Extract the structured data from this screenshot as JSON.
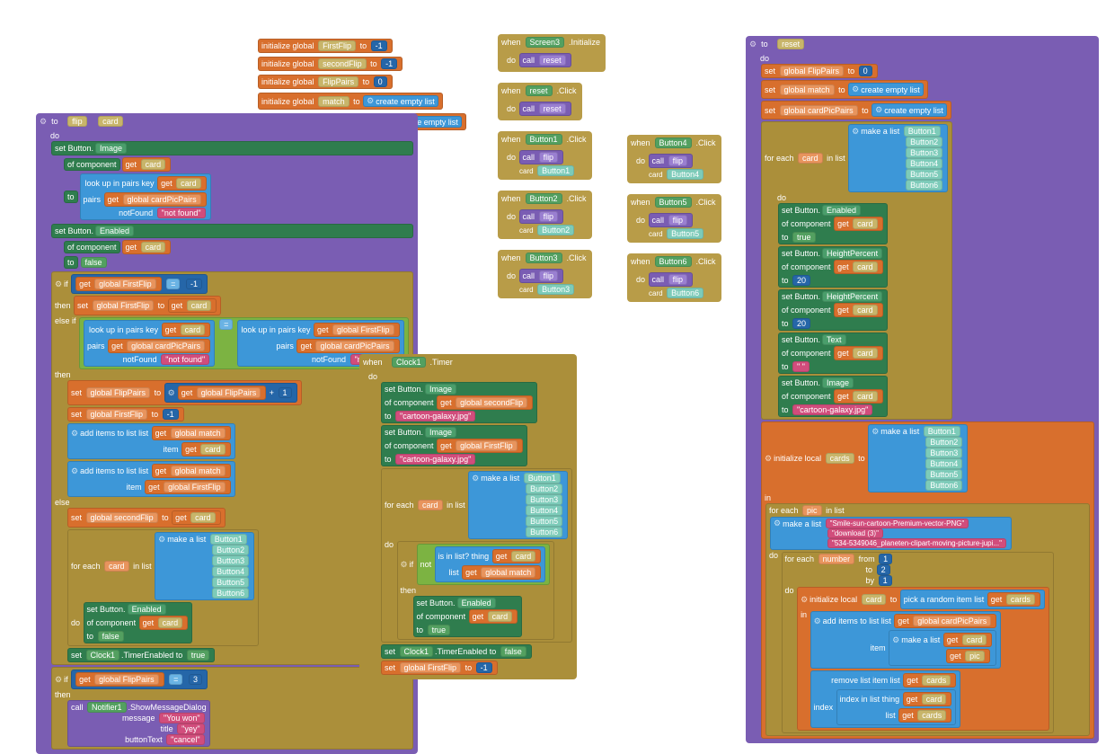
{
  "kw": {
    "when": "when",
    "do": "do",
    "to": "to",
    "call": "call",
    "set": "set",
    "get": "get",
    "of_component": "of component",
    "for_each": "for each",
    "in_list": "in list",
    "if": "if",
    "then": "then",
    "else_if": "else if",
    "else": "else",
    "initialize_global": "initialize global",
    "initialize_local": "initialize local",
    "in": "in",
    "from": "from",
    "by": "by",
    "make_a_list": "make a list",
    "create_empty_list": "create empty list",
    "look_up_pairs_key": "look up in pairs  key",
    "pairs": "pairs",
    "notFound": "notFound",
    "add_items_list": "add items to list  list",
    "item": "item",
    "is_in_list": "is in list? thing",
    "list": "list",
    "pick_random": "pick a random item  list",
    "remove_list_item": "remove list item  list",
    "index": "index",
    "index_in_list": "index in list  thing",
    "set_button": "set Button.",
    "message": "message",
    "title": "title",
    "buttonText": "buttonText",
    "number": "number",
    "card": "card",
    "pic": "pic",
    "cards": "cards"
  },
  "globals": {
    "firstFlip": "FirstFlip",
    "secondFlip": "secondFlip",
    "flipPairs": "FlipPairs",
    "match": "match",
    "cardPicPairs": "cardPicPairs"
  },
  "g_init": {
    "firstFlip_val": "-1",
    "secondFlip_val": "-1",
    "flipPairs_val": "0"
  },
  "comp": {
    "screen3": "Screen3",
    "clock1": "Clock1",
    "notifier1": "Notifier1"
  },
  "events": {
    "initialize": ".Initialize",
    "click": ".Click",
    "timer": ".Timer"
  },
  "procs": {
    "reset": "reset",
    "flip": "flip"
  },
  "props": {
    "image": "Image",
    "enabled": "Enabled",
    "heightPercent": "HeightPercent",
    "text": "Text",
    "timerEnabled": ".TimerEnabled"
  },
  "buttons": [
    "Button1",
    "Button2",
    "Button3",
    "Button4",
    "Button5",
    "Button6"
  ],
  "vals": {
    "false": "false",
    "true": "true",
    "neg1": "-1",
    "one": "1",
    "two": "2",
    "three": "3",
    "twenty": "20",
    "zero": "0",
    "eq": "=",
    "plus": "+",
    "notfound_txt": "not found",
    "quote": "\" \"",
    "galaxy": "cartoon-galaxy.jpg",
    "youwon": "You won",
    "yey": "yey",
    "cancel": "cancel",
    "img1": "Smile-sun-cartoon-Premium-vector-PNG",
    "img2": "download (3)",
    "img3": "534-5349046_planeten-clipart-moving-picture-jupi..."
  },
  "method": {
    "showMsg": ".ShowMessageDialog"
  },
  "gget": {
    "firstFlip": "global FirstFlip",
    "secondFlip": "global secondFlip",
    "flipPairs": "global FlipPairs",
    "match": "global match",
    "cardPicPairs": "global cardPicPairs"
  }
}
